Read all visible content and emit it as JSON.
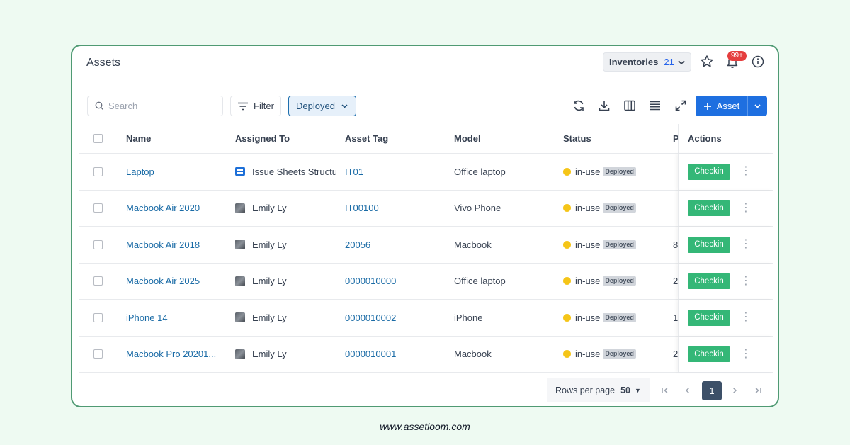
{
  "header": {
    "title": "Assets",
    "inventories_label": "Inventories",
    "inventories_count": "21",
    "notification_badge": "99+"
  },
  "toolbar": {
    "search_placeholder": "Search",
    "filter_label": "Filter",
    "status_filter_label": "Deployed",
    "add_label": "Asset"
  },
  "table": {
    "columns": [
      "Name",
      "Assigned To",
      "Asset Tag",
      "Model",
      "Status",
      "P",
      "Actions"
    ],
    "rows": [
      {
        "name": "Laptop",
        "assigned_to": "Issue Sheets Structu",
        "assignee_type": "sheet-icon",
        "asset_tag": "IT01",
        "model": "Office laptop",
        "status": "in-use",
        "status_badge": "Deployed",
        "p": "",
        "action": "Checkin"
      },
      {
        "name": "Macbook Air 2020",
        "assigned_to": "Emily Ly",
        "assignee_type": "avatar",
        "asset_tag": "IT00100",
        "model": "Vivo Phone",
        "status": "in-use",
        "status_badge": "Deployed",
        "p": "",
        "action": "Checkin"
      },
      {
        "name": "Macbook Air 2018",
        "assigned_to": "Emily Ly",
        "assignee_type": "avatar",
        "asset_tag": "20056",
        "model": "Macbook",
        "status": "in-use",
        "status_badge": "Deployed",
        "p": "8",
        "action": "Checkin"
      },
      {
        "name": "Macbook Air 2025",
        "assigned_to": "Emily Ly",
        "assignee_type": "avatar",
        "asset_tag": "0000010000",
        "model": "Office laptop",
        "status": "in-use",
        "status_badge": "Deployed",
        "p": "2",
        "action": "Checkin"
      },
      {
        "name": "iPhone 14",
        "assigned_to": "Emily Ly",
        "assignee_type": "avatar",
        "asset_tag": "0000010002",
        "model": "iPhone",
        "status": "in-use",
        "status_badge": "Deployed",
        "p": "1(",
        "action": "Checkin"
      },
      {
        "name": "Macbook Pro 20201...",
        "assigned_to": "Emily Ly",
        "assignee_type": "avatar",
        "asset_tag": "0000010001",
        "model": "Macbook",
        "status": "in-use",
        "status_badge": "Deployed",
        "p": "2",
        "action": "Checkin"
      }
    ]
  },
  "pagination": {
    "rows_per_page_label": "Rows per page",
    "rows_per_page_value": "50",
    "current_page": "1"
  },
  "footer": {
    "url": "www.assetloom.com"
  },
  "colors": {
    "background": "#eefaf2",
    "card_border": "#4f9a73",
    "primary": "#1e6fe0",
    "link": "#1a6ba6",
    "checkin": "#34b777",
    "status_dot": "#f5c518",
    "badge": "#e53e3e"
  }
}
